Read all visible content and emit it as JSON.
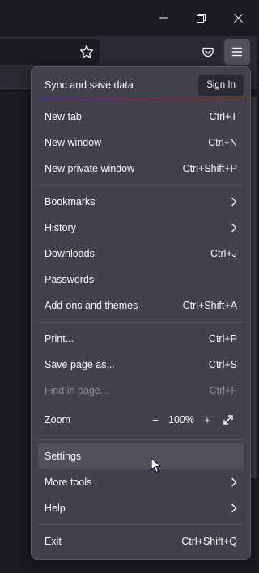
{
  "window": {
    "minimize_icon": "minimize-icon",
    "restore_icon": "restore-icon",
    "close_icon": "close-icon"
  },
  "toolbar": {
    "bookmark_icon": "star-icon",
    "pocket_icon": "pocket-icon",
    "menu_icon": "hamburger-menu-icon"
  },
  "menu": {
    "sync_title": "Sync and save data",
    "sign_in": "Sign In",
    "items": [
      {
        "label": "New tab",
        "shortcut": "Ctrl+T"
      },
      {
        "label": "New window",
        "shortcut": "Ctrl+N"
      },
      {
        "label": "New private window",
        "shortcut": "Ctrl+Shift+P"
      },
      {
        "label": "Bookmarks",
        "shortcut": ""
      },
      {
        "label": "History",
        "shortcut": ""
      },
      {
        "label": "Downloads",
        "shortcut": "Ctrl+J"
      },
      {
        "label": "Passwords",
        "shortcut": ""
      },
      {
        "label": "Add-ons and themes",
        "shortcut": "Ctrl+Shift+A"
      },
      {
        "label": "Print...",
        "shortcut": "Ctrl+P"
      },
      {
        "label": "Save page as...",
        "shortcut": "Ctrl+S"
      },
      {
        "label": "Find in page...",
        "shortcut": "Ctrl+F"
      },
      {
        "label": "Settings",
        "shortcut": ""
      },
      {
        "label": "More tools",
        "shortcut": ""
      },
      {
        "label": "Help",
        "shortcut": ""
      },
      {
        "label": "Exit",
        "shortcut": "Ctrl+Shift+Q"
      }
    ],
    "zoom": {
      "label": "Zoom",
      "minus": "−",
      "value": "100%",
      "plus": "+"
    }
  },
  "colors": {
    "panel_bg": "#42414d",
    "hover_bg": "#52525e",
    "text": "#fbfbfe",
    "disabled_text": "#8f8f9d",
    "accent_gradient": [
      "#9059ff",
      "#ff4aa2",
      "#ffbd4f"
    ]
  }
}
